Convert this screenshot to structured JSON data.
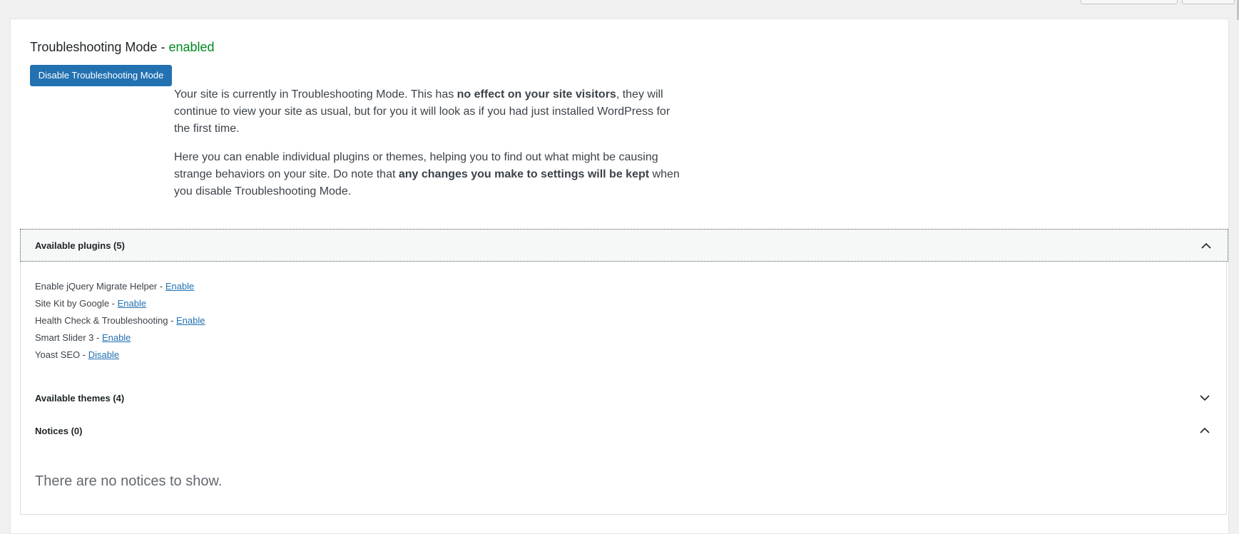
{
  "page": {
    "title_prefix": "Troubleshooting Mode - ",
    "title_status": "enabled",
    "disable_button": "Disable Troubleshooting Mode",
    "intro": {
      "p1_a": "Your site is currently in Troubleshooting Mode. This has ",
      "p1_b": "no effect on your site visitors",
      "p1_c": ", they will continue to view your site as usual, but for you it will look as if you had just installed WordPress for the first time.",
      "p2_a": "Here you can enable individual plugins or themes, helping you to find out what might be causing strange behaviors on your site. Do note that ",
      "p2_b": "any changes you make to settings will be kept",
      "p2_c": " when you disable Troubleshooting Mode."
    }
  },
  "accordion": {
    "plugins_label": "Available plugins (5)",
    "themes_label": "Available themes (4)",
    "notices_label": "Notices (0)",
    "no_notices": "There are no notices to show."
  },
  "plugins": [
    {
      "name": "Enable jQuery Migrate Helper",
      "sep": " - ",
      "action": "Enable"
    },
    {
      "name": "Site Kit by Google",
      "sep": " - ",
      "action": "Enable"
    },
    {
      "name": "Health Check & Troubleshooting",
      "sep": " - ",
      "action": "Enable"
    },
    {
      "name": "Smart Slider 3",
      "sep": " - ",
      "action": "Enable"
    },
    {
      "name": "Yoast SEO",
      "sep": " - ",
      "action": "Disable"
    }
  ],
  "colors": {
    "accent": "#2271b1",
    "status_enabled": "#008a20"
  },
  "icons": {
    "plugins_chevron": "chevron-up-icon",
    "themes_chevron": "chevron-down-icon",
    "notices_chevron": "chevron-up-icon"
  }
}
